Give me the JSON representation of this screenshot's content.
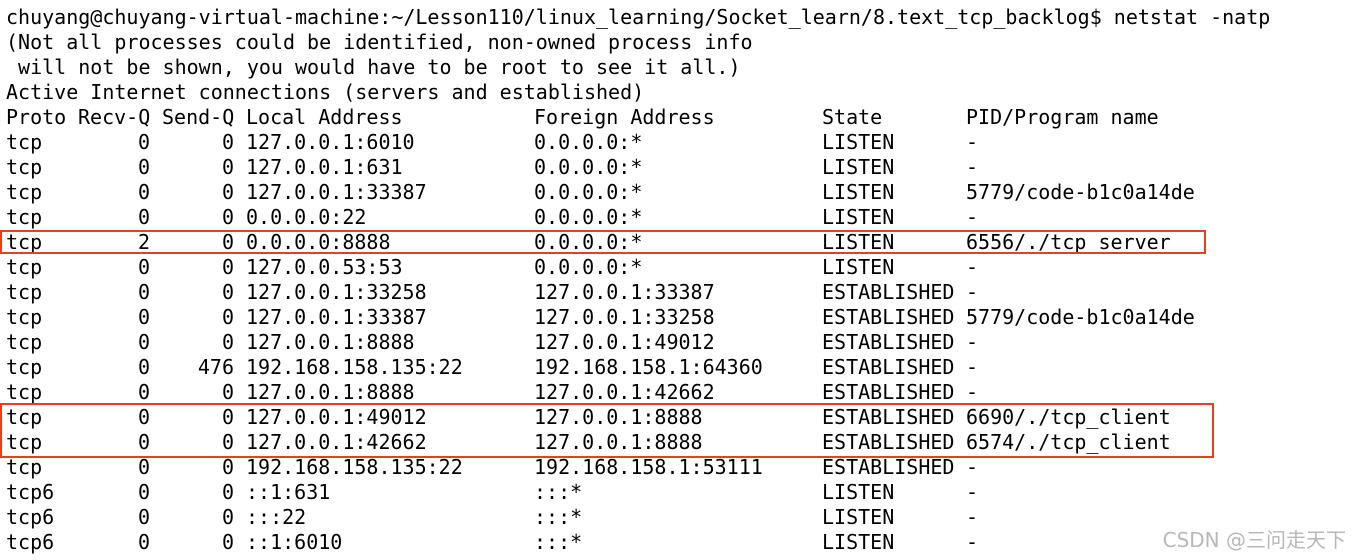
{
  "terminal": {
    "prompt_line": "chuyang@chuyang-virtual-machine:~/Lesson110/linux_learning/Socket_learn/8.text_tcp_backlog$ netstat -natp",
    "note_line_1": "(Not all processes could be identified, non-owned process info",
    "note_line_2": " will not be shown, you would have to be root to see it all.)",
    "section_title": "Active Internet connections (servers and established)",
    "headers": {
      "proto": "Proto",
      "recv_q": "Recv-Q",
      "send_q": "Send-Q",
      "local": "Local Address",
      "foreign": "Foreign Address",
      "state": "State",
      "pid": "PID/Program name"
    },
    "rows": [
      {
        "proto": "tcp",
        "recv": "0",
        "send": "0",
        "local": "127.0.0.1:6010",
        "foreign": "0.0.0.0:*",
        "state": "LISTEN",
        "pid": "-"
      },
      {
        "proto": "tcp",
        "recv": "0",
        "send": "0",
        "local": "127.0.0.1:631",
        "foreign": "0.0.0.0:*",
        "state": "LISTEN",
        "pid": "-"
      },
      {
        "proto": "tcp",
        "recv": "0",
        "send": "0",
        "local": "127.0.0.1:33387",
        "foreign": "0.0.0.0:*",
        "state": "LISTEN",
        "pid": "5779/code-b1c0a14de"
      },
      {
        "proto": "tcp",
        "recv": "0",
        "send": "0",
        "local": "0.0.0.0:22",
        "foreign": "0.0.0.0:*",
        "state": "LISTEN",
        "pid": "-"
      },
      {
        "proto": "tcp",
        "recv": "2",
        "send": "0",
        "local": "0.0.0.0:8888",
        "foreign": "0.0.0.0:*",
        "state": "LISTEN",
        "pid": "6556/./tcp_server"
      },
      {
        "proto": "tcp",
        "recv": "0",
        "send": "0",
        "local": "127.0.0.53:53",
        "foreign": "0.0.0.0:*",
        "state": "LISTEN",
        "pid": "-"
      },
      {
        "proto": "tcp",
        "recv": "0",
        "send": "0",
        "local": "127.0.0.1:33258",
        "foreign": "127.0.0.1:33387",
        "state": "ESTABLISHED",
        "pid": "-"
      },
      {
        "proto": "tcp",
        "recv": "0",
        "send": "0",
        "local": "127.0.0.1:33387",
        "foreign": "127.0.0.1:33258",
        "state": "ESTABLISHED",
        "pid": "5779/code-b1c0a14de"
      },
      {
        "proto": "tcp",
        "recv": "0",
        "send": "0",
        "local": "127.0.0.1:8888",
        "foreign": "127.0.0.1:49012",
        "state": "ESTABLISHED",
        "pid": "-"
      },
      {
        "proto": "tcp",
        "recv": "0",
        "send": "476",
        "local": "192.168.158.135:22",
        "foreign": "192.168.158.1:64360",
        "state": "ESTABLISHED",
        "pid": "-"
      },
      {
        "proto": "tcp",
        "recv": "0",
        "send": "0",
        "local": "127.0.0.1:8888",
        "foreign": "127.0.0.1:42662",
        "state": "ESTABLISHED",
        "pid": "-"
      },
      {
        "proto": "tcp",
        "recv": "0",
        "send": "0",
        "local": "127.0.0.1:49012",
        "foreign": "127.0.0.1:8888",
        "state": "ESTABLISHED",
        "pid": "6690/./tcp_client"
      },
      {
        "proto": "tcp",
        "recv": "0",
        "send": "0",
        "local": "127.0.0.1:42662",
        "foreign": "127.0.0.1:8888",
        "state": "ESTABLISHED",
        "pid": "6574/./tcp_client"
      },
      {
        "proto": "tcp",
        "recv": "0",
        "send": "0",
        "local": "192.168.158.135:22",
        "foreign": "192.168.158.1:53111",
        "state": "ESTABLISHED",
        "pid": "-"
      },
      {
        "proto": "tcp6",
        "recv": "0",
        "send": "0",
        "local": "::1:631",
        "foreign": ":::*",
        "state": "LISTEN",
        "pid": "-"
      },
      {
        "proto": "tcp6",
        "recv": "0",
        "send": "0",
        "local": ":::22",
        "foreign": ":::*",
        "state": "LISTEN",
        "pid": "-"
      },
      {
        "proto": "tcp6",
        "recv": "0",
        "send": "0",
        "local": "::1:6010",
        "foreign": ":::*",
        "state": "LISTEN",
        "pid": "-"
      }
    ]
  },
  "annotations": {
    "highlight_color": "#e8401c",
    "highlighted_server_row": 4,
    "highlighted_client_rows": [
      11,
      12
    ]
  },
  "watermark": {
    "text": "CSDN @三问走天下"
  }
}
